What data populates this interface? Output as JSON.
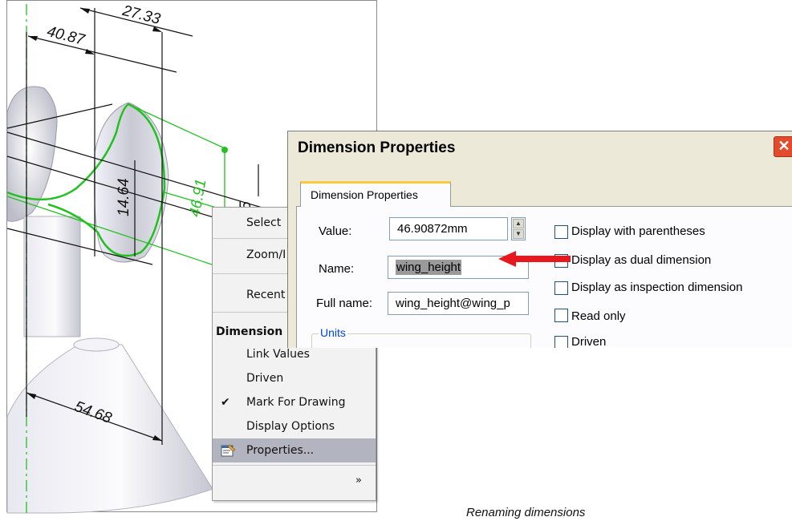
{
  "cad": {
    "dimensions": [
      "27.33",
      "40.87",
      "14.64",
      "54.68"
    ],
    "partial_dimensions": [
      "46.91",
      "5"
    ]
  },
  "context_menu": {
    "items": [
      "Select",
      "Zoom/I",
      "Recent"
    ],
    "section_header": "Dimension",
    "dim_items": [
      "Link Values",
      "Driven",
      "Mark For Drawing",
      "Display Options",
      "Properties..."
    ],
    "checked_mark": "✔",
    "more_chevron": "»"
  },
  "dialog": {
    "title": "Dimension Properties",
    "close_glyph": "✕",
    "tab_label": "Dimension Properties",
    "value_label": "Value:",
    "value": "46.90872mm",
    "name_label": "Name:",
    "name_value": "wing_height",
    "fullname_label": "Full name:",
    "fullname_value": "wing_height@wing_p",
    "units_label": "Units",
    "checkboxes": [
      "Display with parentheses",
      "Display as dual dimension",
      "Display as inspection dimension",
      "Read only",
      "Driven"
    ]
  },
  "caption": "Renaming dimensions",
  "colors": {
    "arrow": "#e8161d",
    "sketch": "#22c020",
    "menu_highlight": "#b2b4bf"
  }
}
